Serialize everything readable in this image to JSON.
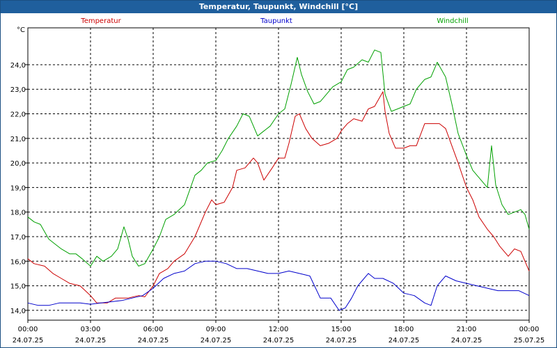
{
  "window": {
    "title": "Temperatur, Taupunkt, Windchill [°C]"
  },
  "chart_data": {
    "type": "line",
    "title": "Temperatur, Taupunkt, Windchill [°C]",
    "ylabel": "°C",
    "ylim": [
      13.6,
      25.5
    ],
    "yticks": [
      "14,0",
      "15,0",
      "16,0",
      "17,0",
      "18,0",
      "19,0",
      "20,0",
      "21,0",
      "22,0",
      "23,0",
      "24,0"
    ],
    "xlim": [
      0,
      24
    ],
    "xticks": [
      {
        "time": "00:00",
        "date": "24.07.25"
      },
      {
        "time": "03:00",
        "date": "24.07.25"
      },
      {
        "time": "06:00",
        "date": "24.07.25"
      },
      {
        "time": "09:00",
        "date": "24.07.25"
      },
      {
        "time": "12:00",
        "date": "24.07.25"
      },
      {
        "time": "15:00",
        "date": "24.07.25"
      },
      {
        "time": "18:00",
        "date": "24.07.25"
      },
      {
        "time": "21:00",
        "date": "24.07.25"
      },
      {
        "time": "00:00",
        "date": "25.07.25"
      }
    ],
    "grid": true,
    "legend_position": "top",
    "series": [
      {
        "name": "Temperatur",
        "color": "#cc0000",
        "points": [
          [
            0,
            16.1
          ],
          [
            0.3,
            15.9
          ],
          [
            0.8,
            15.8
          ],
          [
            1.2,
            15.5
          ],
          [
            1.6,
            15.3
          ],
          [
            2,
            15.1
          ],
          [
            2.5,
            15.0
          ],
          [
            3,
            14.6
          ],
          [
            3.3,
            14.3
          ],
          [
            3.8,
            14.3
          ],
          [
            4.2,
            14.5
          ],
          [
            4.8,
            14.5
          ],
          [
            5.3,
            14.6
          ],
          [
            5.6,
            14.55
          ],
          [
            6,
            15.0
          ],
          [
            6.3,
            15.5
          ],
          [
            6.7,
            15.7
          ],
          [
            7,
            16.0
          ],
          [
            7.5,
            16.3
          ],
          [
            8,
            17.0
          ],
          [
            8.5,
            18.0
          ],
          [
            8.8,
            18.5
          ],
          [
            9,
            18.3
          ],
          [
            9.4,
            18.4
          ],
          [
            9.8,
            19.0
          ],
          [
            10,
            19.7
          ],
          [
            10.4,
            19.8
          ],
          [
            10.8,
            20.2
          ],
          [
            11,
            20.0
          ],
          [
            11.3,
            19.3
          ],
          [
            11.7,
            19.8
          ],
          [
            12,
            20.2
          ],
          [
            12.3,
            20.2
          ],
          [
            12.5,
            20.8
          ],
          [
            12.8,
            21.9
          ],
          [
            13,
            22.0
          ],
          [
            13.3,
            21.4
          ],
          [
            13.6,
            21.0
          ],
          [
            14,
            20.7
          ],
          [
            14.4,
            20.8
          ],
          [
            14.8,
            21.0
          ],
          [
            15,
            21.3
          ],
          [
            15.3,
            21.6
          ],
          [
            15.6,
            21.8
          ],
          [
            16,
            21.7
          ],
          [
            16.3,
            22.2
          ],
          [
            16.6,
            22.3
          ],
          [
            17,
            22.9
          ],
          [
            17.1,
            22.1
          ],
          [
            17.3,
            21.2
          ],
          [
            17.6,
            20.6
          ],
          [
            18,
            20.6
          ],
          [
            18.3,
            20.7
          ],
          [
            18.6,
            20.7
          ],
          [
            19,
            21.6
          ],
          [
            19.4,
            21.6
          ],
          [
            19.7,
            21.6
          ],
          [
            20,
            21.4
          ],
          [
            20.3,
            20.7
          ],
          [
            20.6,
            20.0
          ],
          [
            21,
            19.0
          ],
          [
            21.3,
            18.5
          ],
          [
            21.6,
            17.8
          ],
          [
            22,
            17.3
          ],
          [
            22.3,
            17.0
          ],
          [
            22.6,
            16.6
          ],
          [
            23,
            16.2
          ],
          [
            23.3,
            16.5
          ],
          [
            23.6,
            16.4
          ],
          [
            24,
            15.6
          ]
        ]
      },
      {
        "name": "Taupunkt",
        "color": "#0000cc",
        "points": [
          [
            0,
            14.3
          ],
          [
            0.5,
            14.2
          ],
          [
            1,
            14.2
          ],
          [
            1.5,
            14.3
          ],
          [
            2,
            14.3
          ],
          [
            2.5,
            14.3
          ],
          [
            3,
            14.25
          ],
          [
            3.5,
            14.3
          ],
          [
            4,
            14.35
          ],
          [
            4.5,
            14.4
          ],
          [
            5,
            14.5
          ],
          [
            5.5,
            14.6
          ],
          [
            6,
            14.9
          ],
          [
            6.5,
            15.3
          ],
          [
            7,
            15.5
          ],
          [
            7.5,
            15.6
          ],
          [
            8,
            15.9
          ],
          [
            8.5,
            16.0
          ],
          [
            9,
            16.0
          ],
          [
            9.5,
            15.9
          ],
          [
            10,
            15.7
          ],
          [
            10.5,
            15.7
          ],
          [
            11,
            15.6
          ],
          [
            11.5,
            15.5
          ],
          [
            12,
            15.5
          ],
          [
            12.5,
            15.6
          ],
          [
            13,
            15.5
          ],
          [
            13.5,
            15.4
          ],
          [
            14,
            14.5
          ],
          [
            14.5,
            14.5
          ],
          [
            14.9,
            14.0
          ],
          [
            15.2,
            14.1
          ],
          [
            15.5,
            14.5
          ],
          [
            15.8,
            15.0
          ],
          [
            16,
            15.2
          ],
          [
            16.3,
            15.5
          ],
          [
            16.6,
            15.3
          ],
          [
            17,
            15.3
          ],
          [
            17.5,
            15.1
          ],
          [
            18,
            14.7
          ],
          [
            18.5,
            14.6
          ],
          [
            19,
            14.3
          ],
          [
            19.3,
            14.2
          ],
          [
            19.6,
            15.0
          ],
          [
            20,
            15.4
          ],
          [
            20.5,
            15.2
          ],
          [
            21,
            15.1
          ],
          [
            21.5,
            15.0
          ],
          [
            22,
            14.9
          ],
          [
            22.5,
            14.8
          ],
          [
            23,
            14.8
          ],
          [
            23.5,
            14.8
          ],
          [
            24,
            14.6
          ]
        ]
      },
      {
        "name": "Windchill",
        "color": "#00a000",
        "points": [
          [
            0,
            17.8
          ],
          [
            0.3,
            17.6
          ],
          [
            0.6,
            17.5
          ],
          [
            1,
            16.9
          ],
          [
            1.3,
            16.7
          ],
          [
            1.6,
            16.5
          ],
          [
            2,
            16.3
          ],
          [
            2.3,
            16.3
          ],
          [
            2.6,
            16.1
          ],
          [
            3,
            15.8
          ],
          [
            3.3,
            16.2
          ],
          [
            3.6,
            16.0
          ],
          [
            4,
            16.2
          ],
          [
            4.3,
            16.5
          ],
          [
            4.6,
            17.4
          ],
          [
            4.8,
            16.9
          ],
          [
            5,
            16.2
          ],
          [
            5.3,
            15.8
          ],
          [
            5.6,
            15.9
          ],
          [
            6,
            16.5
          ],
          [
            6.3,
            17.0
          ],
          [
            6.6,
            17.7
          ],
          [
            7,
            17.9
          ],
          [
            7.5,
            18.3
          ],
          [
            8,
            19.5
          ],
          [
            8.3,
            19.7
          ],
          [
            8.6,
            20.0
          ],
          [
            9,
            20.1
          ],
          [
            9.3,
            20.5
          ],
          [
            9.6,
            21.0
          ],
          [
            10,
            21.5
          ],
          [
            10.3,
            22.0
          ],
          [
            10.6,
            21.9
          ],
          [
            11,
            21.1
          ],
          [
            11.3,
            21.3
          ],
          [
            11.6,
            21.5
          ],
          [
            12,
            22.0
          ],
          [
            12.3,
            22.2
          ],
          [
            12.6,
            23.2
          ],
          [
            12.9,
            24.3
          ],
          [
            13.1,
            23.6
          ],
          [
            13.4,
            22.9
          ],
          [
            13.7,
            22.4
          ],
          [
            14,
            22.5
          ],
          [
            14.3,
            22.8
          ],
          [
            14.6,
            23.1
          ],
          [
            15,
            23.3
          ],
          [
            15.3,
            23.8
          ],
          [
            15.6,
            23.9
          ],
          [
            16,
            24.2
          ],
          [
            16.3,
            24.1
          ],
          [
            16.6,
            24.6
          ],
          [
            16.9,
            24.5
          ],
          [
            17.1,
            22.8
          ],
          [
            17.4,
            22.1
          ],
          [
            17.7,
            22.2
          ],
          [
            18,
            22.3
          ],
          [
            18.3,
            22.4
          ],
          [
            18.6,
            23.0
          ],
          [
            19,
            23.4
          ],
          [
            19.3,
            23.5
          ],
          [
            19.6,
            24.1
          ],
          [
            20,
            23.5
          ],
          [
            20.3,
            22.4
          ],
          [
            20.6,
            21.2
          ],
          [
            21,
            20.3
          ],
          [
            21.3,
            19.7
          ],
          [
            21.6,
            19.4
          ],
          [
            22,
            19.0
          ],
          [
            22.2,
            20.7
          ],
          [
            22.4,
            19.1
          ],
          [
            22.7,
            18.3
          ],
          [
            23,
            17.9
          ],
          [
            23.3,
            18.0
          ],
          [
            23.6,
            18.1
          ],
          [
            23.8,
            17.9
          ],
          [
            24,
            17.3
          ]
        ]
      }
    ]
  }
}
